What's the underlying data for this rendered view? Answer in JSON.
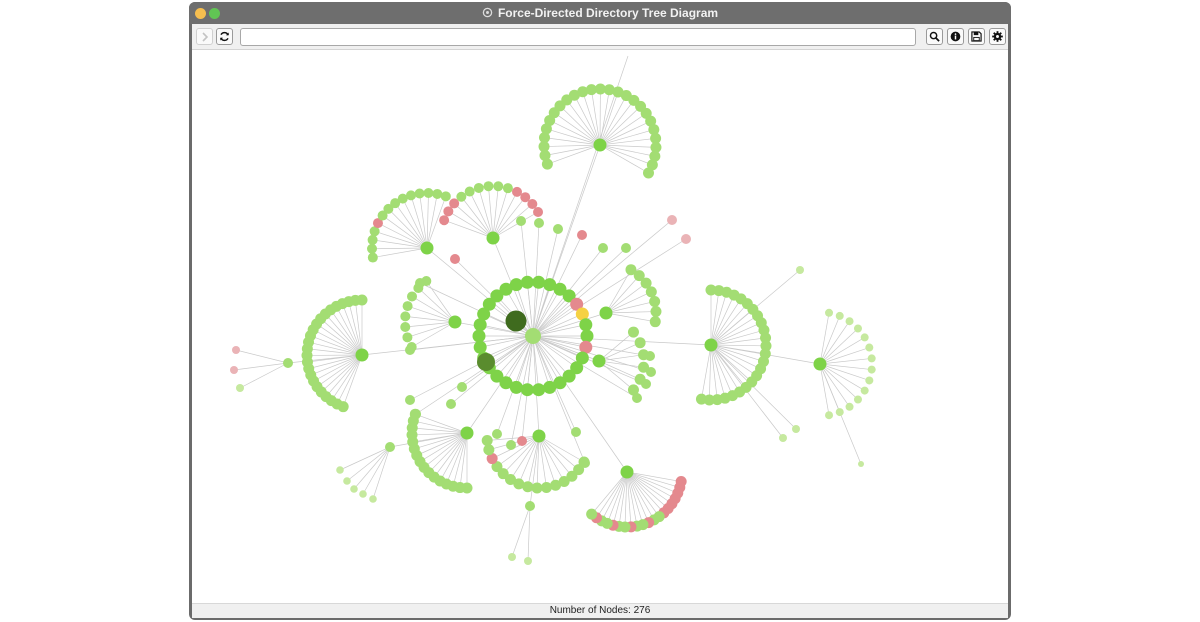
{
  "window": {
    "title": "Force-Directed Directory Tree Diagram"
  },
  "toolbar": {
    "address_value": "",
    "icons": [
      "chevron-right-icon",
      "refresh-icon",
      "search-icon",
      "info-icon",
      "save-icon",
      "gear-icon"
    ]
  },
  "graph": {
    "node_colors": {
      "folder": "#7ed348",
      "file": "#a3dd73",
      "file_light": "#c6e99f",
      "alert": "#e4898e",
      "alert_light": "#eab3b6",
      "warning": "#f5d143",
      "root": "#3f6b1e",
      "hub": "#5a8c2e",
      "link": "#c9c9c9"
    },
    "labels": {
      "root": "",
      "hub": "",
      "center": ""
    }
  },
  "status": {
    "node_count_text": "Number of Nodes: 276"
  }
}
